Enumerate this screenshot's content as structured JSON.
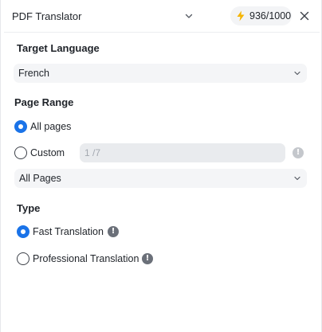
{
  "header": {
    "tool_select_value": "PDF Translator",
    "credits": "936/1000",
    "icons": {
      "dropdown": "chevron-down-icon",
      "credits": "lightning-icon",
      "close": "close-icon"
    }
  },
  "target_language": {
    "label": "Target Language",
    "value": "French"
  },
  "page_range": {
    "label": "Page Range",
    "options": [
      {
        "label": "All pages",
        "selected": true
      },
      {
        "label": "Custom",
        "selected": false
      }
    ],
    "custom_placeholder": "1 /7",
    "pages_select_value": "All Pages"
  },
  "type": {
    "label": "Type",
    "options": [
      {
        "label": "Fast Translation",
        "selected": true
      },
      {
        "label": "Professional Translation",
        "selected": false
      }
    ]
  },
  "colors": {
    "accent": "#1a73e8",
    "credits_icon": "#f5b400",
    "info_icon": "#6b7079",
    "info_icon_disabled": "#c4c7cc"
  }
}
